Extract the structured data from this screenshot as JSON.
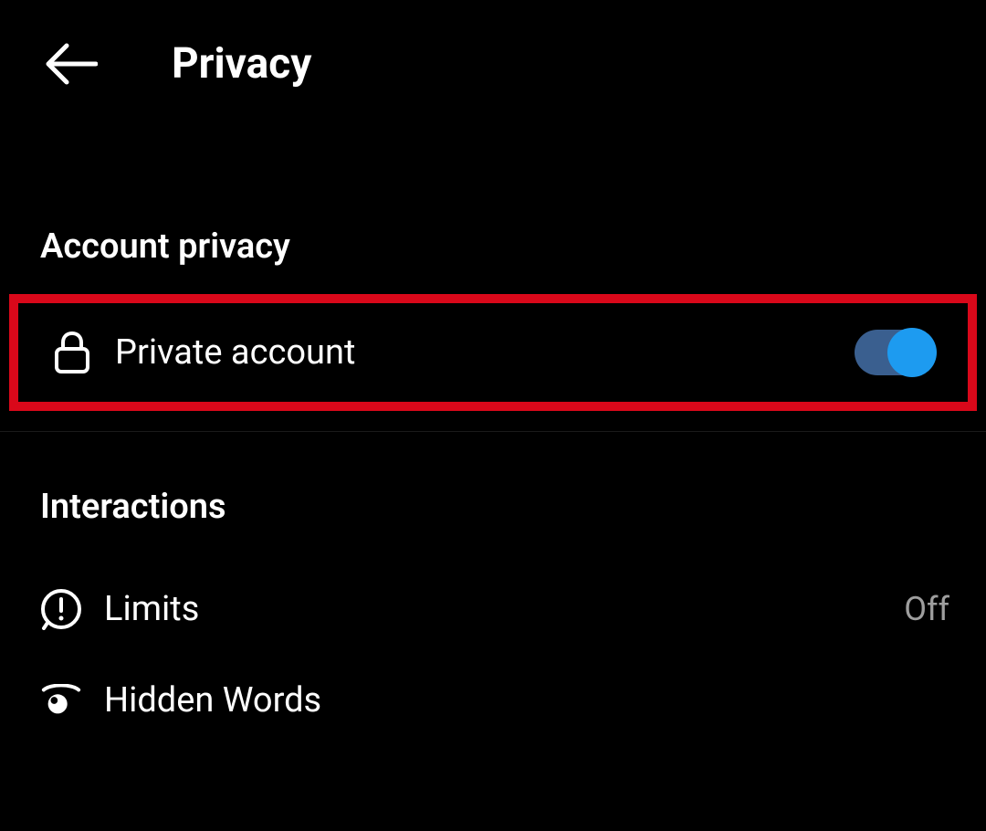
{
  "header": {
    "title": "Privacy"
  },
  "sections": {
    "account_privacy": {
      "header": "Account privacy",
      "private_account": {
        "label": "Private account",
        "toggle_on": true
      }
    },
    "interactions": {
      "header": "Interactions",
      "limits": {
        "label": "Limits",
        "value": "Off"
      },
      "hidden_words": {
        "label": "Hidden Words"
      }
    }
  }
}
